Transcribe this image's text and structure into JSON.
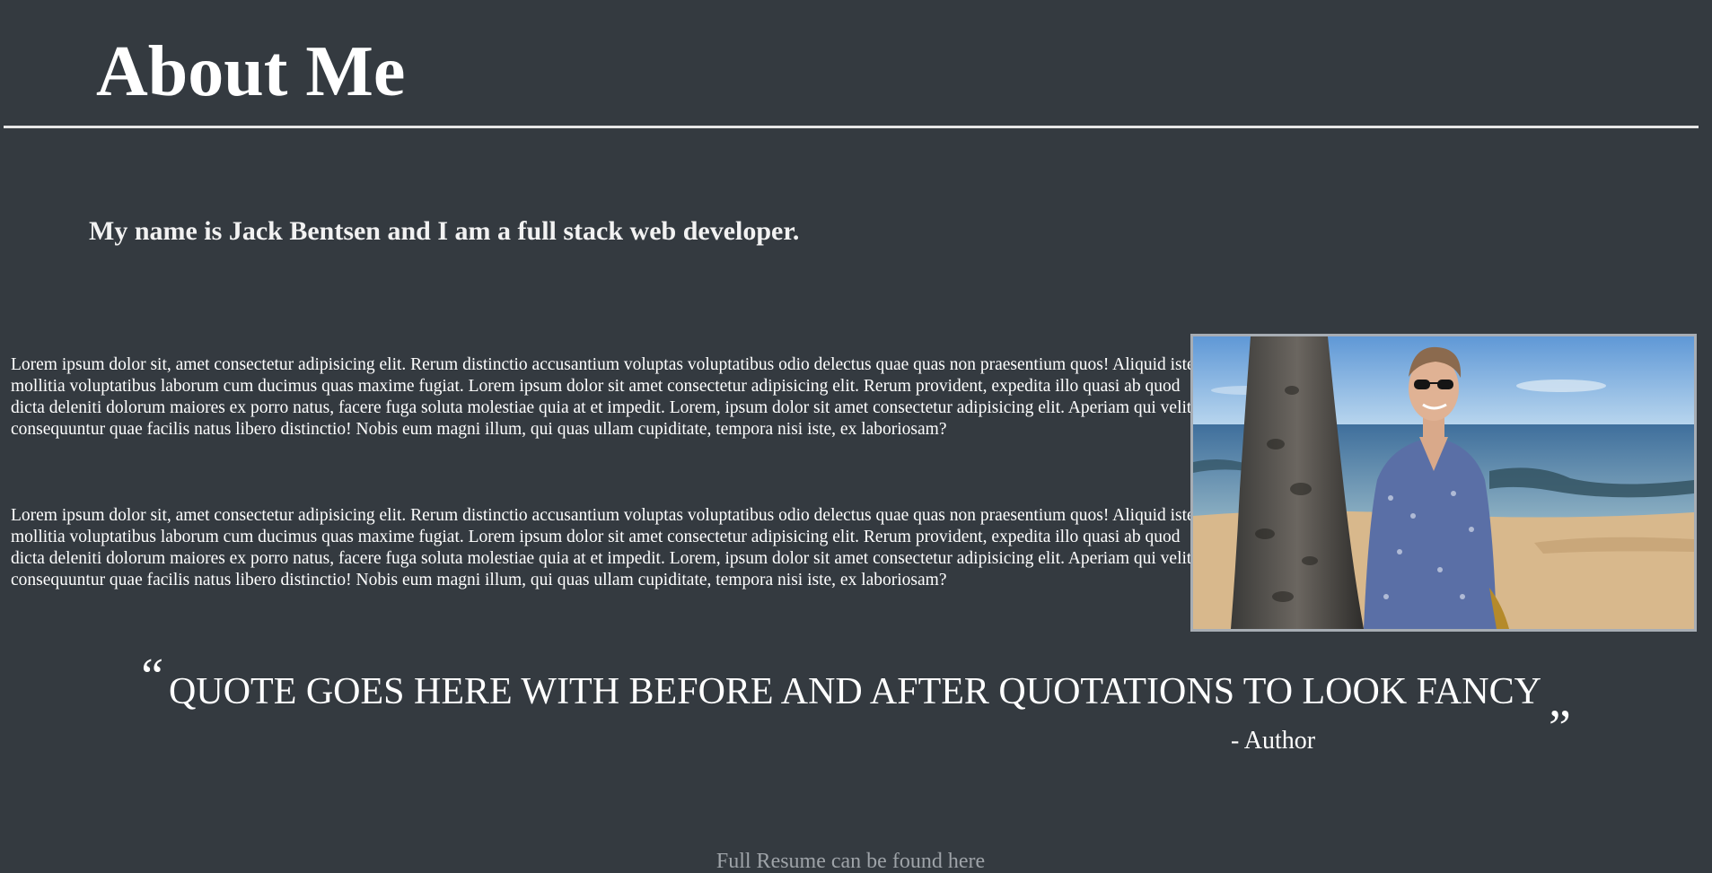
{
  "header": {
    "title": "About Me"
  },
  "intro": {
    "text": "My name is Jack Bentsen and I am a full stack web developer."
  },
  "bio": {
    "paragraphs": [
      "Lorem ipsum dolor sit, amet consectetur adipisicing elit. Rerum distinctio accusantium voluptas voluptatibus odio delectus quae quas non praesentium quos! Aliquid iste mollitia voluptatibus laborum cum ducimus quas maxime fugiat. Lorem ipsum dolor sit amet consectetur adipisicing elit. Rerum provident, expedita illo quasi ab quod dicta deleniti dolorum maiores ex porro natus, facere fuga soluta molestiae quia at et impedit. Lorem, ipsum dolor sit amet consectetur adipisicing elit. Aperiam qui velit consequuntur quae facilis natus libero distinctio! Nobis eum magni illum, qui quas ullam cupiditate, tempora nisi iste, ex laboriosam?",
      "Lorem ipsum dolor sit, amet consectetur adipisicing elit. Rerum distinctio accusantium voluptas voluptatibus odio delectus quae quas non praesentium quos! Aliquid iste mollitia voluptatibus laborum cum ducimus quas maxime fugiat. Lorem ipsum dolor sit amet consectetur adipisicing elit. Rerum provident, expedita illo quasi ab quod dicta deleniti dolorum maiores ex porro natus, facere fuga soluta molestiae quia at et impedit. Lorem, ipsum dolor sit amet consectetur adipisicing elit. Aperiam qui velit consequuntur quae facilis natus libero distinctio! Nobis eum magni illum, qui quas ullam cupiditate, tempora nisi iste, ex laboriosam?"
    ]
  },
  "photo": {
    "icon": "profile-photo"
  },
  "quote": {
    "open_mark": "“",
    "text": "QUOTE GOES HERE WITH BEFORE AND AFTER QUOTATIONS TO LOOK FANCY",
    "close_mark": "„",
    "author": "- Author"
  },
  "footer": {
    "resume_link": "Full Resume can be found here"
  },
  "colors": {
    "background": "#343a40",
    "text": "#ffffff",
    "divider": "#e6e6e6",
    "link": "#9ea3a8"
  }
}
